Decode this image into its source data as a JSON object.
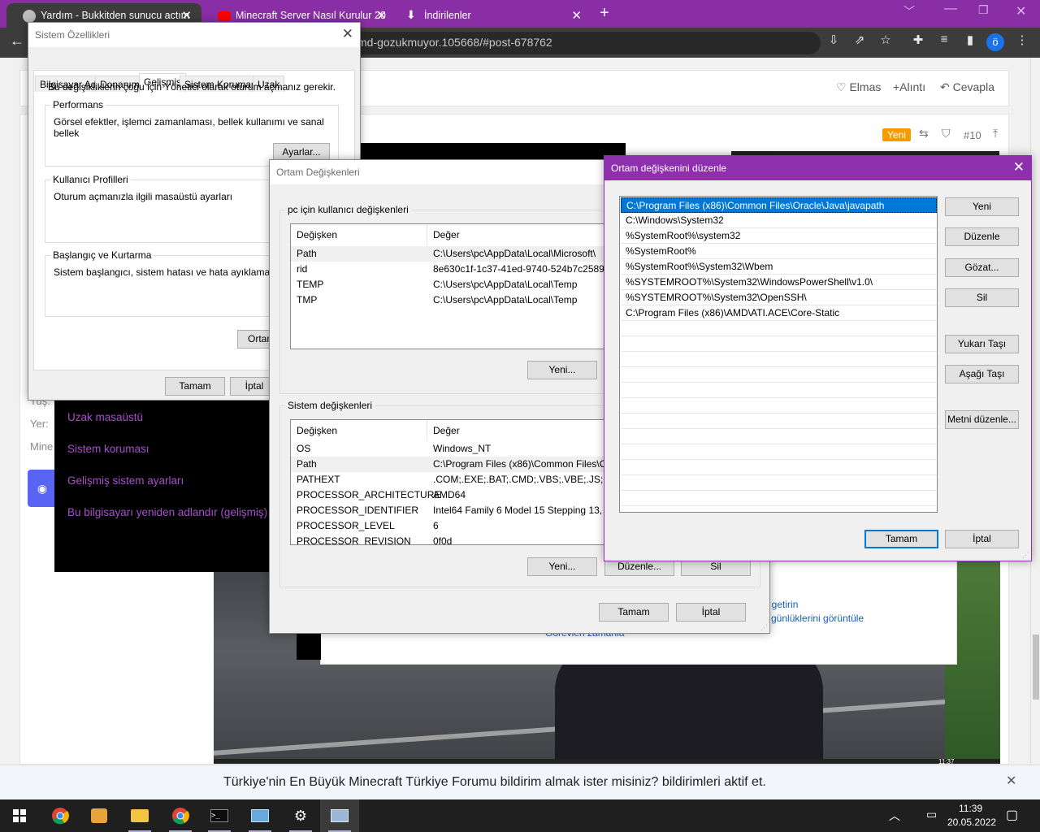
{
  "browser": {
    "tabs": [
      {
        "title": "Yardım - Bukkitden sunucu actım",
        "active": true
      },
      {
        "title": "Minecraft Server Nasıl Kurulur 20",
        "active": false
      },
      {
        "title": "İndirilenler",
        "active": false
      }
    ],
    "new_tab": "+",
    "url": "md-gozukmuyor.105668/#post-678762",
    "profile_initial": "ö"
  },
  "forum": {
    "actions": [
      "Elmas",
      "+Alıntı",
      "Cevapla"
    ],
    "badge_new": "Yeni",
    "post_number": "#10",
    "side_labels": [
      "Tuş:",
      "Yer:",
      "Mine"
    ],
    "background_links": [
      "na getirin",
      "ay günlüklerini görüntüle",
      "Görevleri zamanla"
    ],
    "video_time": "11:37"
  },
  "control_panel": {
    "links": [
      "Uzak masaüstü",
      "Sistem koruması",
      "Gelişmiş sistem ayarları",
      "Bu bilgisayarı yeniden adlandır (gelişmiş)"
    ]
  },
  "system_properties": {
    "title": "Sistem Özellikleri",
    "tabs": [
      "Bilgisayar Adı",
      "Donanım",
      "Gelişmiş",
      "Sistem Koruması",
      "Uzak"
    ],
    "admin_note": "Bu değişikliklerin çoğu için Yönetici olarak oturum açmanız gerekir.",
    "performance": {
      "title": "Performans",
      "desc": "Görsel efektler, işlemci zamanlaması, bellek kullanımı ve sanal bellek",
      "button": "Ayarlar..."
    },
    "profiles": {
      "title": "Kullanıcı Profilleri",
      "desc": "Oturum açmanızla ilgili masaüstü ayarları"
    },
    "startup": {
      "title": "Başlangıç ve Kurtarma",
      "desc": "Sistem başlangıcı, sistem hatası ve hata ayıklama bilgisi"
    },
    "env_button": "Ortam",
    "ok": "Tamam",
    "cancel": "İptal"
  },
  "env_vars": {
    "title": "Ortam Değişkenleri",
    "user_group": "pc için kullanıcı değişkenleri",
    "col_var": "Değişken",
    "col_val": "Değer",
    "user_vars": [
      {
        "name": "Path",
        "value": "C:\\Users\\pc\\AppData\\Local\\Microsoft\\"
      },
      {
        "name": "rid",
        "value": "8e630c1f-1c37-41ed-9740-524b7c2589d2"
      },
      {
        "name": "TEMP",
        "value": "C:\\Users\\pc\\AppData\\Local\\Temp"
      },
      {
        "name": "TMP",
        "value": "C:\\Users\\pc\\AppData\\Local\\Temp"
      }
    ],
    "user_new": "Yeni...",
    "system_group": "Sistem değişkenleri",
    "system_vars": [
      {
        "name": "OS",
        "value": "Windows_NT"
      },
      {
        "name": "Path",
        "value": "C:\\Program Files (x86)\\Common Files\\O"
      },
      {
        "name": "PATHEXT",
        "value": ".COM;.EXE;.BAT;.CMD;.VBS;.VBE;.JS;.JSE;."
      },
      {
        "name": "PROCESSOR_ARCHITECTURE",
        "value": "AMD64"
      },
      {
        "name": "PROCESSOR_IDENTIFIER",
        "value": "Intel64 Family 6 Model 15 Stepping 13, G"
      },
      {
        "name": "PROCESSOR_LEVEL",
        "value": "6"
      },
      {
        "name": "PROCESSOR_REVISION",
        "value": "0f0d"
      }
    ],
    "sys_new": "Yeni...",
    "sys_edit": "Düzenle...",
    "sys_delete": "Sil",
    "ok": "Tamam",
    "cancel": "İptal"
  },
  "edit_env": {
    "title": "Ortam değişkenini düzenle",
    "paths": [
      "C:\\Program Files (x86)\\Common Files\\Oracle\\Java\\javapath",
      "C:\\Windows\\System32",
      "%SystemRoot%\\system32",
      "%SystemRoot%",
      "%SystemRoot%\\System32\\Wbem",
      "%SYSTEMROOT%\\System32\\WindowsPowerShell\\v1.0\\",
      "%SYSTEMROOT%\\System32\\OpenSSH\\",
      "C:\\Program Files (x86)\\AMD\\ATI.ACE\\Core-Static"
    ],
    "buttons": {
      "new": "Yeni",
      "edit": "Düzenle",
      "browse": "Gözat...",
      "delete": "Sil",
      "move_up": "Yukarı Taşı",
      "move_down": "Aşağı Taşı",
      "edit_text": "Metni düzenle..."
    },
    "ok": "Tamam",
    "cancel": "İptal"
  },
  "notification": {
    "text_bold": "Türkiye'nin En Büyük Minecraft Türkiye Forumu bildirim almak ister misiniz?",
    "text_rest": "bildirimleri aktif et."
  },
  "taskbar": {
    "time": "11:39",
    "date": "20.05.2022"
  }
}
